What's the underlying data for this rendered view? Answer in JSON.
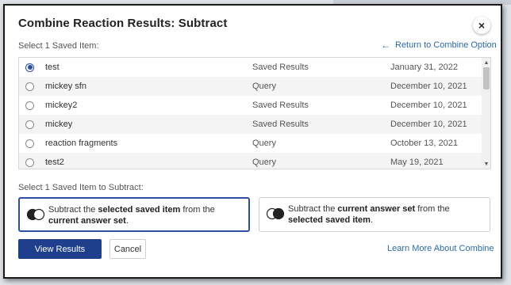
{
  "dialog": {
    "title": "Combine Reaction Results: Subtract",
    "close_glyph": "×"
  },
  "saved_items_section": {
    "label": "Select 1 Saved Item:",
    "return_link": "Return to Combine Option",
    "return_icon": "arrow-left-icon"
  },
  "saved_items": [
    {
      "name": "test",
      "type": "Saved Results",
      "date": "January 31, 2022",
      "selected": true
    },
    {
      "name": "mickey sfn",
      "type": "Query",
      "date": "December 10, 2021",
      "selected": false
    },
    {
      "name": "mickey2",
      "type": "Saved Results",
      "date": "December 10, 2021",
      "selected": false
    },
    {
      "name": "mickey",
      "type": "Saved Results",
      "date": "December 10, 2021",
      "selected": false
    },
    {
      "name": "reaction fragments",
      "type": "Query",
      "date": "October 13, 2021",
      "selected": false
    },
    {
      "name": "test2",
      "type": "Query",
      "date": "May 19, 2021",
      "selected": false
    }
  ],
  "scrollbar": {
    "up_glyph": "▲",
    "down_glyph": "▼"
  },
  "subtract_section": {
    "label": "Select 1 Saved Item to Subtract:",
    "options": [
      {
        "selected": true,
        "parts": [
          "Subtract the ",
          "selected saved item",
          " from the ",
          "current answer set",
          "."
        ]
      },
      {
        "selected": false,
        "parts": [
          "Subtract the ",
          "current answer set",
          " from the ",
          "selected saved item",
          "."
        ]
      }
    ]
  },
  "footer": {
    "view_results": "View Results",
    "cancel": "Cancel",
    "learn_more": "Learn More About Combine"
  },
  "colors": {
    "primary": "#1f3f8c",
    "link": "#2c6aa8",
    "selected_border": "#2c4fa3"
  }
}
